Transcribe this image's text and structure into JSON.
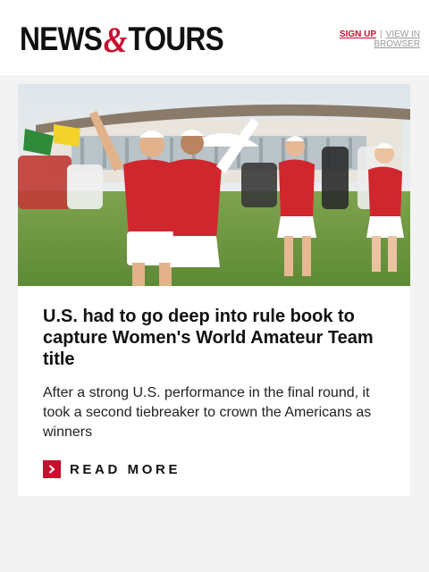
{
  "header": {
    "logo": {
      "part1": "NEWS",
      "amp": "&",
      "part2": "TOURS"
    },
    "links": {
      "signup": "SIGN UP",
      "separator": "|",
      "view_in_browser": "VIEW IN BROWSER"
    }
  },
  "article": {
    "image_subject": "golfers-celebrating-photo",
    "headline": "U.S. had to go deep into rule book to capture Women's World Amateur Team title",
    "summary": "After a strong U.S. performance in the final round, it took a second tiebreaker to crown the Americans as winners",
    "read_more": "READ MORE",
    "read_more_icon": "chevron-right-icon"
  },
  "colors": {
    "brand_red": "#c8102e",
    "page_background": "#f3f3f3",
    "card_background": "#ffffff",
    "text": "#111111"
  }
}
